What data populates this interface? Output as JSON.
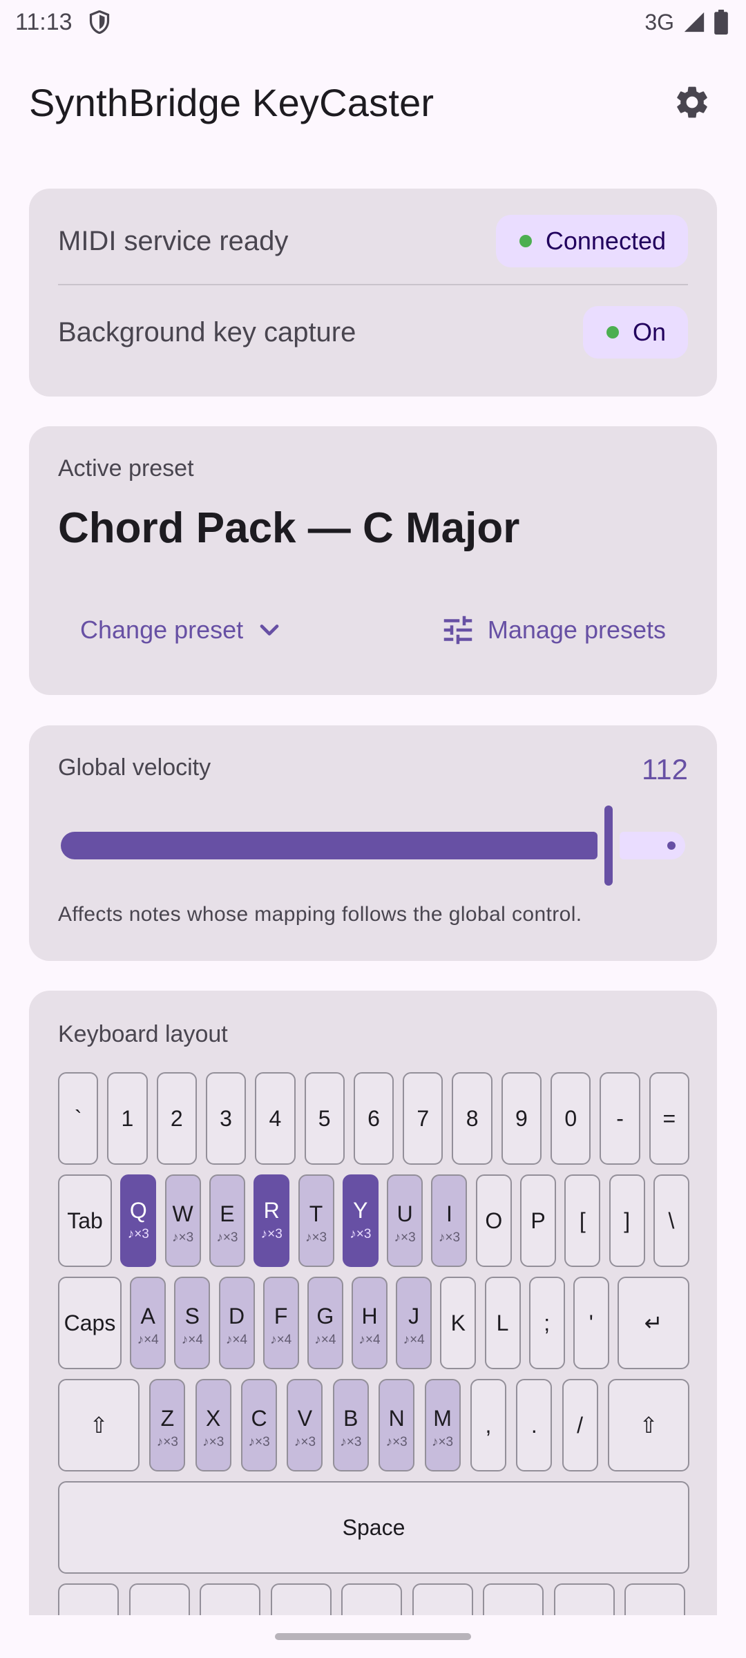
{
  "status_bar": {
    "time": "11:13",
    "network": "3G"
  },
  "app_bar": {
    "title": "SynthBridge KeyCaster"
  },
  "status_card": {
    "rows": [
      {
        "label": "MIDI service ready",
        "badge": "Connected"
      },
      {
        "label": "Background key capture",
        "badge": "On"
      }
    ],
    "badge_dot_color": "#4caf50"
  },
  "preset_card": {
    "caption": "Active preset",
    "name": "Chord Pack — C Major",
    "change_label": "Change preset",
    "manage_label": "Manage presets"
  },
  "velocity_card": {
    "label": "Global velocity",
    "value": 112,
    "max": 127,
    "help": "Affects notes whose mapping follows the global control."
  },
  "keyboard_card": {
    "title": "Keyboard layout",
    "rows": [
      [
        {
          "label": "`"
        },
        {
          "label": "1"
        },
        {
          "label": "2"
        },
        {
          "label": "3"
        },
        {
          "label": "4"
        },
        {
          "label": "5"
        },
        {
          "label": "6"
        },
        {
          "label": "7"
        },
        {
          "label": "8"
        },
        {
          "label": "9"
        },
        {
          "label": "0"
        },
        {
          "label": "-"
        },
        {
          "label": "="
        }
      ],
      [
        {
          "label": "Tab"
        },
        {
          "label": "Q",
          "sub": "♪×3",
          "state": "active"
        },
        {
          "label": "W",
          "sub": "♪×3",
          "state": "mapped"
        },
        {
          "label": "E",
          "sub": "♪×3",
          "state": "mapped"
        },
        {
          "label": "R",
          "sub": "♪×3",
          "state": "active"
        },
        {
          "label": "T",
          "sub": "♪×3",
          "state": "mapped"
        },
        {
          "label": "Y",
          "sub": "♪×3",
          "state": "active"
        },
        {
          "label": "U",
          "sub": "♪×3",
          "state": "mapped"
        },
        {
          "label": "I",
          "sub": "♪×3",
          "state": "mapped"
        },
        {
          "label": "O"
        },
        {
          "label": "P"
        },
        {
          "label": "["
        },
        {
          "label": "]"
        },
        {
          "label": "\\"
        }
      ],
      [
        {
          "label": "Caps"
        },
        {
          "label": "A",
          "sub": "♪×4",
          "state": "mapped"
        },
        {
          "label": "S",
          "sub": "♪×4",
          "state": "mapped"
        },
        {
          "label": "D",
          "sub": "♪×4",
          "state": "mapped"
        },
        {
          "label": "F",
          "sub": "♪×4",
          "state": "mapped"
        },
        {
          "label": "G",
          "sub": "♪×4",
          "state": "mapped"
        },
        {
          "label": "H",
          "sub": "♪×4",
          "state": "mapped"
        },
        {
          "label": "J",
          "sub": "♪×4",
          "state": "mapped"
        },
        {
          "label": "K"
        },
        {
          "label": "L"
        },
        {
          "label": ";"
        },
        {
          "label": "'"
        },
        {
          "label": "↵"
        }
      ],
      [
        {
          "label": "⇧"
        },
        {
          "label": "Z",
          "sub": "♪×3",
          "state": "mapped"
        },
        {
          "label": "X",
          "sub": "♪×3",
          "state": "mapped"
        },
        {
          "label": "C",
          "sub": "♪×3",
          "state": "mapped"
        },
        {
          "label": "V",
          "sub": "♪×3",
          "state": "mapped"
        },
        {
          "label": "B",
          "sub": "♪×3",
          "state": "mapped"
        },
        {
          "label": "N",
          "sub": "♪×3",
          "state": "mapped"
        },
        {
          "label": "M",
          "sub": "♪×3",
          "state": "mapped"
        },
        {
          "label": ","
        },
        {
          "label": "."
        },
        {
          "label": "/"
        },
        {
          "label": "⇧"
        }
      ],
      [
        {
          "label": "Space"
        }
      ]
    ]
  },
  "colors": {
    "accent": "#6750a4",
    "card": "#e7e0e8",
    "mapped_key": "#c7bcdc",
    "active_key": "#6750a4"
  }
}
